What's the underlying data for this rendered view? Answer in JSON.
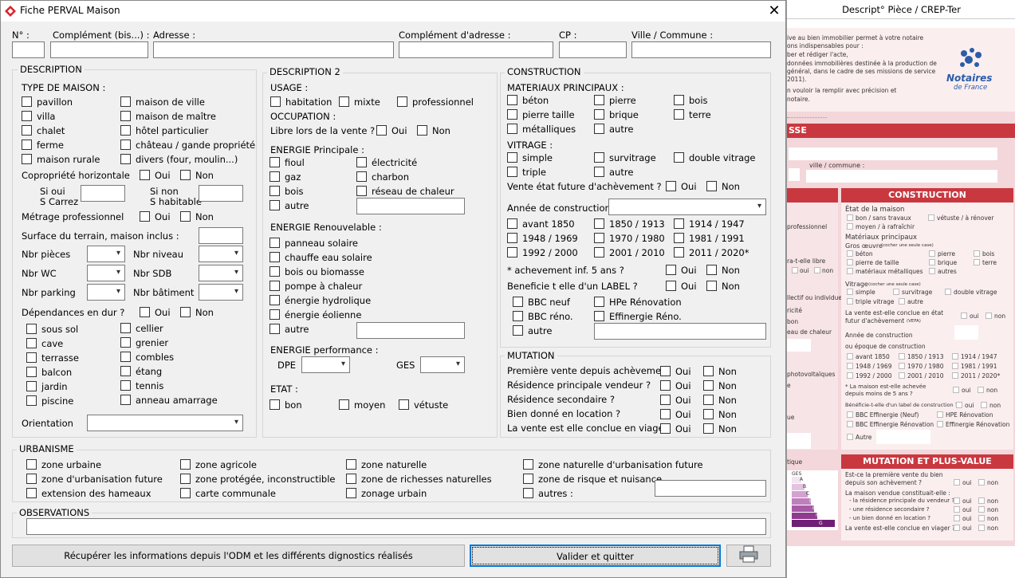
{
  "window": {
    "title": "Fiche PERVAL Maison",
    "close_icon": "close-icon"
  },
  "address": {
    "n": "N° :",
    "complement_bis": "Complément (bis...) :",
    "adresse": "Adresse :",
    "complement_adresse": "Complément d'adresse :",
    "cp": "CP :",
    "ville": "Ville / Commune :"
  },
  "description": {
    "title": "DESCRIPTION",
    "type_label": "TYPE DE MAISON :",
    "types": [
      "pavillon",
      "maison de ville",
      "villa",
      "maison de maître",
      "chalet",
      "hôtel particulier",
      "ferme",
      "château / gande propriété",
      "maison rurale",
      "divers (four, moulin...)"
    ],
    "copro": "Copropriété horizontale",
    "oui": "Oui",
    "non": "Non",
    "si_oui": "Si oui",
    "s_carrez": "S Carrez",
    "si_non": "Si non",
    "s_habitable": "S habitable",
    "metrage": "Métrage professionnel",
    "surface": "Surface du terrain, maison inclus :",
    "nbr_pieces": "Nbr pièces",
    "nbr_niveau": "Nbr niveau",
    "nbr_wc": "Nbr WC",
    "nbr_sdb": "Nbr SDB",
    "nbr_parking": "Nbr parking",
    "nbr_batiment": "Nbr bâtiment",
    "dependances": "Dépendances en dur ?",
    "deps": [
      "sous sol",
      "cellier",
      "cave",
      "grenier",
      "terrasse",
      "combles",
      "balcon",
      "étang",
      "jardin",
      "tennis",
      "piscine",
      "anneau amarrage"
    ],
    "orientation": "Orientation"
  },
  "description2": {
    "title": "DESCRIPTION 2",
    "usage": "USAGE :",
    "habitation": "habitation",
    "mixte": "mixte",
    "professionnel": "professionnel",
    "occupation": "OCCUPATION :",
    "libre": "Libre lors de la vente ?",
    "oui": "Oui",
    "non": "Non",
    "energie_principale": "ENERGIE Principale :",
    "ep": [
      "fioul",
      "électricité",
      "gaz",
      "charbon",
      "bois",
      "réseau de chaleur",
      "autre"
    ],
    "energie_renouvelable": "ENERGIE Renouvelable :",
    "er": [
      "panneau solaire",
      "chauffe eau solaire",
      "bois ou biomasse",
      "pompe à chaleur",
      "énergie hydrolique",
      "énergie éolienne",
      "autre"
    ],
    "energie_performance": "ENERGIE performance :",
    "dpe": "DPE",
    "ges": "GES",
    "etat": "ETAT :",
    "bon": "bon",
    "moyen": "moyen",
    "vetuste": "vétuste"
  },
  "construction": {
    "title": "CONSTRUCTION",
    "materiaux": "MATERIAUX PRINCIPAUX  :",
    "mats": [
      "béton",
      "pierre",
      "bois",
      "pierre taille",
      "brique",
      "terre",
      "métalliques",
      "autre"
    ],
    "vitrage": "VITRAGE  :",
    "vits": [
      "simple",
      "survitrage",
      "double vitrage",
      "triple",
      "autre"
    ],
    "vente_future": "Vente état future d'achèvement ?",
    "annee": "Année de construction",
    "annees": [
      "avant 1850",
      "1850 / 1913",
      "1914 / 1947",
      "1948 / 1969",
      "1970 / 1980",
      "1981 / 1991",
      "1992 / 2000",
      "2001 / 2010",
      "2011 / 2020*"
    ],
    "achevement": "* achevement inf. 5 ans ?",
    "label": "Beneficie t elle d'un LABEL  ?",
    "labels": [
      "BBC neuf",
      "HPe Rénovation",
      "BBC réno.",
      "Effinergie Réno.",
      "autre"
    ],
    "oui": "Oui",
    "non": "Non"
  },
  "mutation": {
    "title": "MUTATION",
    "rows": [
      "Première vente depuis achèvement",
      "Résidence principale vendeur ?",
      "Résidence secondaire ?",
      "Bien donné en location ?",
      "La vente est elle conclue en viager"
    ],
    "oui": "Oui",
    "non": "Non"
  },
  "urbanisme": {
    "title": "URBANISME",
    "items": [
      "zone urbaine",
      "zone agricole",
      "zone naturelle",
      "zone naturelle d'urbanisation future",
      "zone d'urbanisation future",
      "zone protégée, inconstructible",
      "zone de richesses naturelles",
      "zone de risque et nuisance",
      "extension des hameaux",
      "carte communale",
      "zonage urbain",
      "autres :"
    ]
  },
  "observations": {
    "title": "OBSERVATIONS"
  },
  "buttons": {
    "recuperer": "Récupérer les informations depuis l'ODM et les différents dignostics réalisés",
    "valider": "Valider et quitter",
    "print_icon": "printer-icon"
  },
  "background": {
    "title": "Descript° Pièce / CREP-Ter",
    "intro": [
      "ive au bien immobilier permet à votre notaire",
      "ons indispensables pour :",
      "ber et rédiger l'acte,",
      "données immobilières destinée à la production de",
      "général, dans le cadre de ses missions de service",
      "2011).",
      "n vouloir la remplir avec précision et",
      "notaire."
    ],
    "logo_line1": "Notaires",
    "logo_line2": "de France",
    "ville_label": "ville / commune :",
    "hdr_esse": "SSE",
    "hdr_construction": "CONSTRUCTION",
    "hdr_mutation": "MUTATION ET PLUS-VALUE",
    "left_texts": [
      "professionnel",
      "ra-t-elle libre",
      "oui",
      "non",
      "llectif ou individuel)",
      "ricité",
      "bon",
      "eau de chaleur",
      "photovoltaïques",
      "e",
      "ue",
      "tique"
    ],
    "etat_title": "État de la maison",
    "etat_items": [
      "bon / sans travaux",
      "vétuste / à rénover",
      "moyen / à rafraîchir"
    ],
    "mat_title": "Matériaux principaux",
    "gros_oeuvre": "Gros œuvre",
    "gros_oeuvre_note": "(cocher une seule case)",
    "mat_items": [
      "béton",
      "pierre",
      "bois",
      "pierre de taille",
      "brique",
      "terre",
      "matériaux métalliques",
      "autres"
    ],
    "vitrage_title": "Vitrage",
    "vitrage_note": "(cocher une seule case)",
    "vitrage_items": [
      "simple",
      "survitrage",
      "double vitrage",
      "triple vitrage",
      "autre"
    ],
    "vefa_q1": "La vente est-elle conclue en état",
    "vefa_q2": "futur d'achèvement",
    "vefa_note": "(VEFA)",
    "oui": "oui",
    "non": "non",
    "annee_title1": "Année de construction",
    "annee_title2": "ou époque de construction",
    "annee_items": [
      "avant 1850",
      "1850 / 1913",
      "1914 / 1947",
      "1948 / 1969",
      "1970 / 1980",
      "1981 / 1991",
      "1992 / 2000",
      "2001 / 2010",
      "2011 / 2020*"
    ],
    "achevee_q1": "* La maison est-elle achevée",
    "achevee_q2": "depuis moins de 5 ans ?",
    "label_q": "Bénéficie-t-elle d'un label de construction ?",
    "label_items": [
      "BBC Effinergie (Neuf)",
      "HPE Rénovation",
      "BBC Effinergie Rénovation",
      "Effinergie Rénovation",
      "Autre"
    ],
    "ges_label": "GES",
    "ges_letters": [
      "A",
      "B",
      "C",
      "D",
      "E",
      "F",
      "G"
    ],
    "mut_q1": "Est-ce la première vente du bien",
    "mut_q2": "depuis son achèvement ?",
    "mut_q3": "La maison vendue constituait-elle :",
    "mut_sub": [
      "- la résidence principale du vendeur ?",
      "- une résidence secondaire ?",
      "- un bien donné en location ?"
    ],
    "mut_viager": "La vente est-elle conclue en viager ?"
  },
  "colors": {
    "accent": "#0078d7",
    "brand_red": "#c9383f",
    "doc_pink": "#f3d7da"
  }
}
